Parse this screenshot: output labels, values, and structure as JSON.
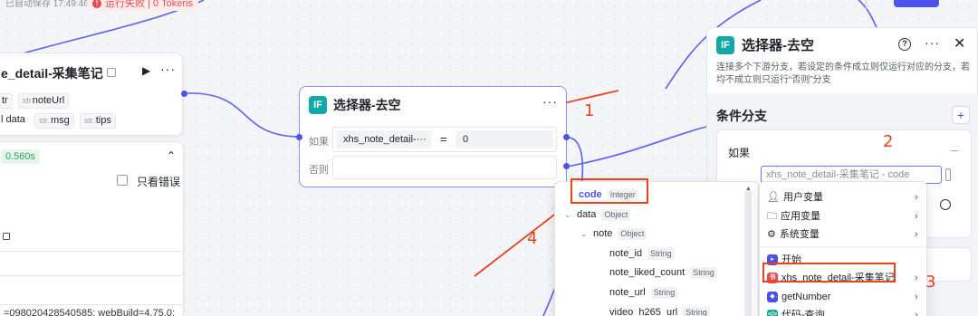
{
  "topbar": {
    "autosave": "已自动保存 17:49:46",
    "run_status": "运行失败 | 0 Tokens",
    "run_status_icon": "error-icon"
  },
  "left_node": {
    "title": "e_detail-采集笔记",
    "outputs_row1": [
      {
        "type": "str",
        "name": "noteUrl"
      }
    ],
    "first_partial": "tr",
    "outputs_row2": [
      {
        "type": "",
        "name": "data"
      },
      {
        "type": "str.",
        "name": "msg"
      },
      {
        "type": "str.",
        "name": "tips"
      }
    ]
  },
  "result_panel": {
    "time": "0.560s",
    "only_errors_label": "只看错误",
    "log_text": "=098020428540585; webBuild=4.75.0;"
  },
  "selector_node": {
    "title": "选择器-去空",
    "if_label": "如果",
    "else_label": "否则",
    "condition_var": "xhs_note_detail-···",
    "operator": "=",
    "value": "0"
  },
  "right_panel": {
    "title": "选择器-去空",
    "description": "连接多个下游分支，若设定的条件成立则仅运行对应的分支，若均不成立则只运行“否则”分支",
    "section_title": "条件分支",
    "if_label": "如果",
    "selected_var": "xhs_note_detail-采集笔记 - code",
    "add_label": "+"
  },
  "var_tree": [
    {
      "name": "code",
      "type": "Integer",
      "depth": 0,
      "caret": "",
      "selected": true
    },
    {
      "name": "data",
      "type": "Object",
      "depth": 0,
      "caret": "⌄",
      "selected": false
    },
    {
      "name": "note",
      "type": "Object",
      "depth": 1,
      "caret": "⌄",
      "selected": false
    },
    {
      "name": "note_id",
      "type": "String",
      "depth": 2,
      "caret": "",
      "selected": false
    },
    {
      "name": "note_liked_count",
      "type": "String",
      "depth": 2,
      "caret": "",
      "selected": false
    },
    {
      "name": "note_url",
      "type": "String",
      "depth": 2,
      "caret": "",
      "selected": false
    },
    {
      "name": "video_h265_url",
      "type": "String",
      "depth": 2,
      "caret": "",
      "selected": false
    }
  ],
  "var_sources": [
    {
      "label": "用户变量",
      "icon": "user-icon"
    },
    {
      "label": "应用变量",
      "icon": "folder-icon"
    },
    {
      "label": "系统变量",
      "icon": "gear-icon"
    },
    {
      "label": "开始",
      "icon": "start-node-icon",
      "color": "#4d53e8"
    },
    {
      "label": "xhs_note_detail-采集笔记",
      "icon": "xhs-plugin-icon",
      "color": "#e5484d"
    },
    {
      "label": "getNumber",
      "icon": "code-node-icon",
      "color": "#4d53e8"
    },
    {
      "label": "代码-查询",
      "icon": "code-node-icon",
      "color": "#11a98a"
    }
  ],
  "annotations": [
    "1",
    "2",
    "3",
    "4"
  ],
  "colors": {
    "accent": "#4d53e8",
    "annotation": "#e8431f",
    "if_badge": "#11a9a5",
    "success": "#2ea35a",
    "error": "#e5484d"
  }
}
